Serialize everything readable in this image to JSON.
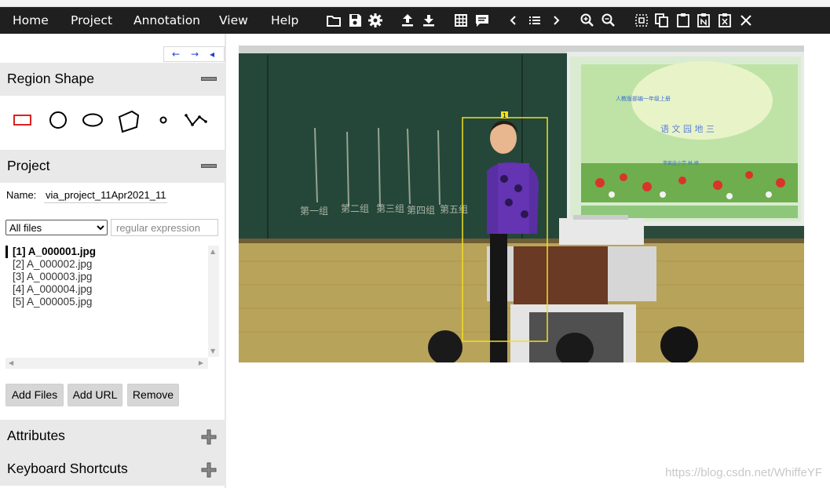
{
  "menu": {
    "items": [
      {
        "label": "Home"
      },
      {
        "label": "Project"
      },
      {
        "label": "Annotation"
      },
      {
        "label": "View"
      },
      {
        "label": "Help"
      }
    ]
  },
  "toolbar": {
    "icons": [
      "folder-open-icon",
      "save-icon",
      "settings-gear-icon",
      "upload-icon",
      "download-icon",
      "grid-view-icon",
      "comment-icon",
      "previous-chevron-icon",
      "list-icon",
      "next-chevron-icon",
      "zoom-in-icon",
      "zoom-out-icon",
      "select-all-regions-icon",
      "copy-icon",
      "paste-icon",
      "paste-n-icon",
      "delete-region-icon",
      "close-icon"
    ]
  },
  "nav_arrows": {
    "left": "←",
    "right": "→",
    "collapse": "◂"
  },
  "region_shape": {
    "title": "Region Shape",
    "shapes": [
      "rectangle",
      "circle",
      "ellipse",
      "polygon",
      "point",
      "polyline"
    ],
    "accent_color": "#e02020"
  },
  "project": {
    "title": "Project",
    "name_label": "Name:",
    "name_value": "via_project_11Apr2021_11",
    "filter_selected": "All files",
    "regex_placeholder": "regular expression",
    "files": [
      {
        "label": "[1] A_000001.jpg",
        "active": true
      },
      {
        "label": "[2] A_000002.jpg",
        "active": false
      },
      {
        "label": "[3] A_000003.jpg",
        "active": false
      },
      {
        "label": "[4] A_000004.jpg",
        "active": false
      },
      {
        "label": "[5] A_000005.jpg",
        "active": false
      }
    ],
    "buttons": {
      "add_files": "Add Files",
      "add_url": "Add URL",
      "remove": "Remove"
    }
  },
  "attributes": {
    "title": "Attributes"
  },
  "keyboard_shortcuts": {
    "title": "Keyboard Shortcuts"
  },
  "annotation": {
    "region_label": "1",
    "box_color": "#f0e020",
    "slide": {
      "subtitle": "人教版部编一年级上册",
      "title": "语 文 园 地 三",
      "author": "李家庄小学   林 婷"
    },
    "chalkboard_text": [
      "第一组",
      "第二组",
      "第三组",
      "第四组",
      "第五组"
    ]
  },
  "watermark": "https://blog.csdn.net/WhiffeYF"
}
